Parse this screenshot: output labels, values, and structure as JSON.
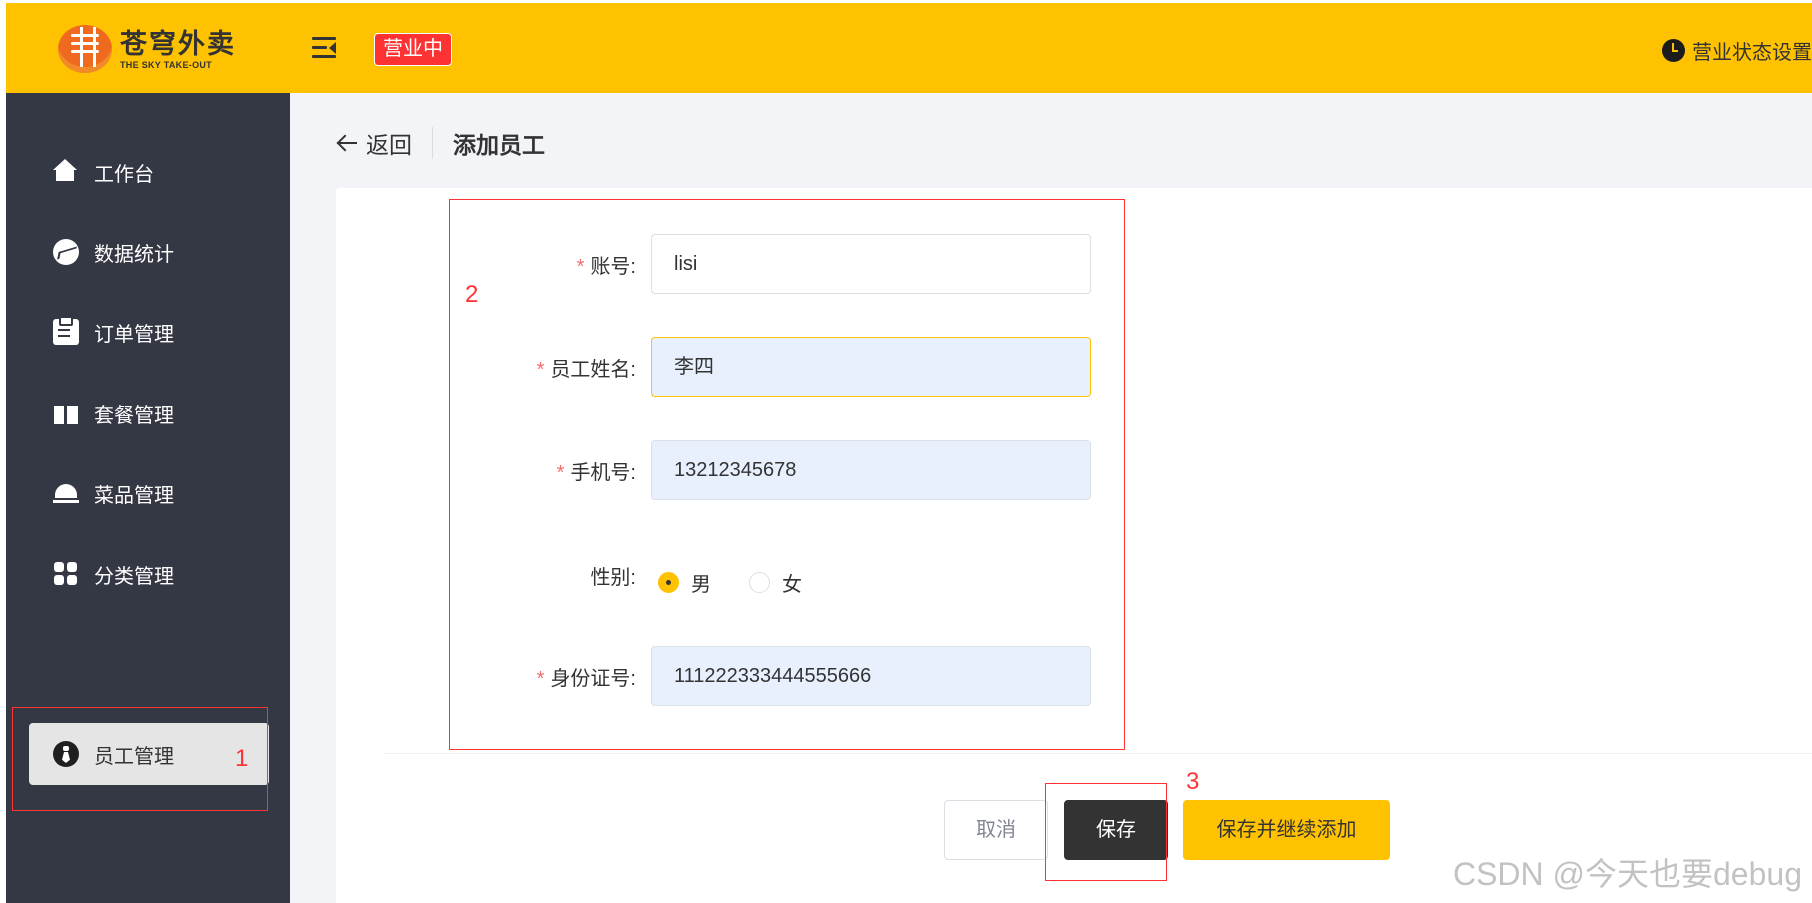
{
  "app": {
    "logo_cn": "苍穹外卖",
    "logo_en": "THE SKY TAKE-OUT",
    "status_badge": "营业中",
    "status_setting_label": "营业状态设置"
  },
  "sidebar": {
    "items": [
      {
        "label": "工作台",
        "icon": "home-icon"
      },
      {
        "label": "数据统计",
        "icon": "chart-icon"
      },
      {
        "label": "订单管理",
        "icon": "clipboard-icon"
      },
      {
        "label": "套餐管理",
        "icon": "gift-icon"
      },
      {
        "label": "菜品管理",
        "icon": "dish-icon"
      },
      {
        "label": "分类管理",
        "icon": "grid-icon"
      },
      {
        "label": "员工管理",
        "icon": "employee-icon",
        "active": true
      }
    ]
  },
  "page": {
    "back_label": "返回",
    "title": "添加员工"
  },
  "form": {
    "account": {
      "label": "账号:",
      "required": "*",
      "value": "lisi"
    },
    "name": {
      "label": "员工姓名:",
      "required": "*",
      "value": "李四"
    },
    "phone": {
      "label": "手机号:",
      "required": "*",
      "value": "13212345678"
    },
    "gender": {
      "label": "性别:",
      "options": [
        "男",
        "女"
      ],
      "selected": "男"
    },
    "id_number": {
      "label": "身份证号:",
      "required": "*",
      "value": "111222333444555666"
    }
  },
  "buttons": {
    "cancel": "取消",
    "save": "保存",
    "save_continue": "保存并继续添加"
  },
  "annotations": {
    "box1": "1",
    "box2": "2",
    "box3": "3"
  },
  "watermark": "CSDN @今天也要debug",
  "colors": {
    "brand": "#ffc200",
    "sidebar": "#343744",
    "badge": "#fd3333",
    "annotation": "#ff3333"
  }
}
